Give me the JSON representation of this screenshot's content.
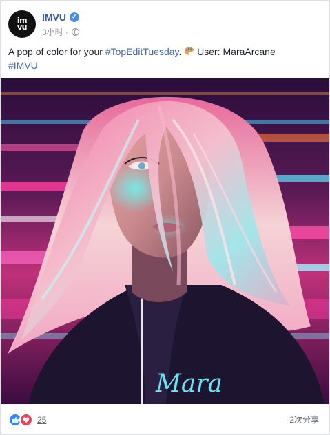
{
  "post": {
    "page_name": "IMVU",
    "avatar_text_1": "im",
    "avatar_text_2": "vu",
    "timestamp": "3小时",
    "separator": "·",
    "privacy_icon": "globe-icon",
    "verified_icon": "verified-check-icon",
    "text": {
      "part1": "A pop of color for your ",
      "hashtag1": "#TopEditTuesday",
      "part2": ". ",
      "emoji": "artist-palette-emoji",
      "part3": " User: MaraArcane",
      "hashtag2": "#IMVU"
    },
    "image": {
      "signature": "Mara"
    }
  },
  "footer": {
    "reaction_icons": [
      "like-icon",
      "love-icon"
    ],
    "reaction_count": "25",
    "shares": "2次分享"
  },
  "colors": {
    "link": "#365899",
    "hashtag": "#4267b2",
    "meta": "#90949c",
    "like": "#2d88ff",
    "love": "#f33e58"
  }
}
